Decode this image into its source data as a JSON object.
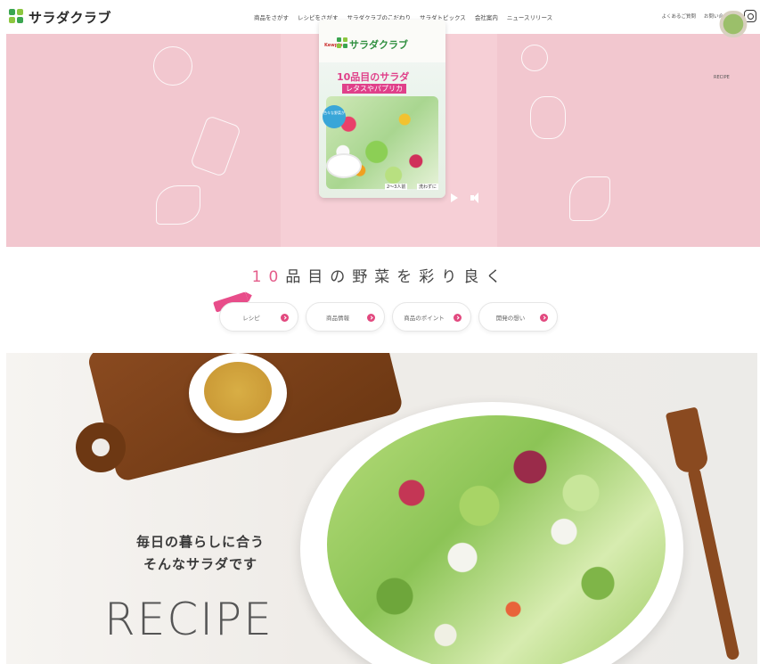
{
  "header": {
    "logo_text": "サラダクラブ",
    "nav": [
      "商品をさがす",
      "レシピをさがす",
      "サラダクラブのこだわり",
      "サラダトピックス",
      "会社案内",
      "ニュースリリース"
    ],
    "utility": [
      "よくあるご質問",
      "お問い合わせ"
    ],
    "instagram_icon": "instagram-icon"
  },
  "hero": {
    "package": {
      "maker": "Kewpie",
      "brand": "サラダクラブ",
      "name": "10品目のサラダ",
      "sub": "レタスやパプリカ",
      "bubble": "色々な野菜が",
      "badge_serving": "2〜3人前",
      "badge_wash": "洗わずに"
    },
    "thumb_label": "RECIPE",
    "colors": {
      "bg": "#f2c7cf",
      "accent": "#e0408a"
    }
  },
  "tagline": {
    "number": "10",
    "text": "品目の野菜を彩り良く"
  },
  "buttons": [
    {
      "label": "レシピ"
    },
    {
      "label": "商品情報"
    },
    {
      "label": "商品のポイント"
    },
    {
      "label": "開発の想い"
    }
  ],
  "recipe": {
    "line1": "毎日の暮らしに合う",
    "line2": "そんなサラダです",
    "title": "RECIPE"
  }
}
